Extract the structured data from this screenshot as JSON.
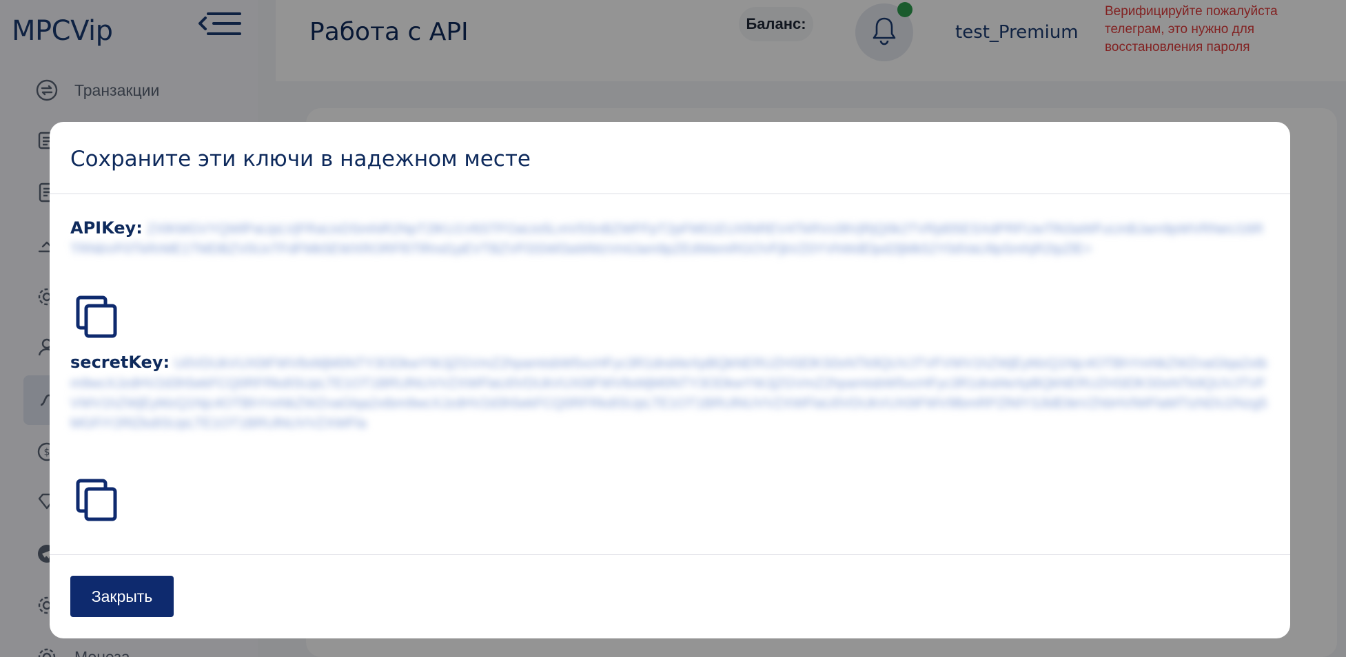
{
  "sidebar": {
    "logo": "MPCVip",
    "items": [
      {
        "label": "Транзакции",
        "icon": "exchange-icon",
        "active": false
      },
      {
        "label": "",
        "icon": "receipt-icon",
        "active": false
      },
      {
        "label": "",
        "icon": "document-icon",
        "active": false
      },
      {
        "label": "",
        "icon": "upload-icon",
        "active": false
      },
      {
        "label": "",
        "icon": "gear-icon",
        "active": false
      },
      {
        "label": "",
        "icon": "user-icon",
        "active": false
      },
      {
        "label": "",
        "icon": "api-icon",
        "active": true
      },
      {
        "label": "",
        "icon": "coin-icon",
        "active": false
      },
      {
        "label": "",
        "icon": "diamond-icon",
        "active": false
      },
      {
        "label": "",
        "icon": "telegram-icon",
        "active": false
      },
      {
        "label": "",
        "icon": "settings-icon",
        "active": false
      },
      {
        "label": "Монеза",
        "icon": "gear-icon",
        "active": false
      }
    ]
  },
  "header": {
    "title": "Работа с API",
    "balance_label": "Баланс:",
    "username": "test_Premium",
    "verify_warning": "Верифицируйте пожалуйста телеграм, это нужно для восстановления пароля",
    "notification_status_color": "#2e9e4f"
  },
  "modal": {
    "title": "Сохраните эти ключи в надежном месте",
    "api_key_label": "APIKey:",
    "api_key_value": "ZXlKMGVYQWlPaUpLVjFRaUxDSmhiR2NpT2lKU1V6STFOaUo5LmV5SnBZWFFpT2pFM01EUXlNREV4TkRVc0ltVjRjQ0k2TVRjd05ESXdPRFUwTlN3aWFuUnBJam9pWVRNeU16RTRNbVF0TkRrME1TMDBZV0UxTFdFMk5EWXRORFl5TlRnd1pEVTBZVFl3SWl3aWMzVmlJam9pZEdWemRGOVFjbVZ0YVhWdElpd2ljMk52Y0dVaU9pSmhjR2tpZlE=",
    "secret_key_label": "secretKey:",
    "secret_key_value": "U0VDUkVUX0tFWV8xMjM0NTY3ODkwYWJjZGVmZ2hpamtsbW5vcHFyc3R1dnd4eXpBQkNERUZHSElKS0xNTk9QUVJTVFVWV1hZWjEyMzQ1Njc4OTBhYmNkZWZnaGlqa2xtbm9wcXJzdHV2d3h5ekFCQ0RFRkdISUpLTE1OT1BRUlNUVVZXWFlaU0VDUkVUX0tFWV8xMjM0NTY3ODkwYWJjZGVmZ2hpamtsbW5vcHFyc3R1dnd4eXpBQkNERUZHSElKS0xNTk9QUVJTVFVWV1hZWjEyMzQ1Njc4OTBhYmNkZWZnaGlqa2xtbm9wcXJzdHV2d3h5ekFCQ0RFRkdISUpLTE1OT1BRUlNUVVZXWFlaU0VDUkVUX0tFWV9lbmRPZlNlY3JldEtleVZhbHVlWFlaMTIzNDU2Nzg5MGFiY2RlZkdISUpLTE1OT1BRUlNUVVZXWFla",
    "close_label": "Закрыть"
  },
  "colors": {
    "brand_navy": "#0e2a6e",
    "warning_red": "#e03b3b",
    "status_green": "#2e9e4f"
  }
}
